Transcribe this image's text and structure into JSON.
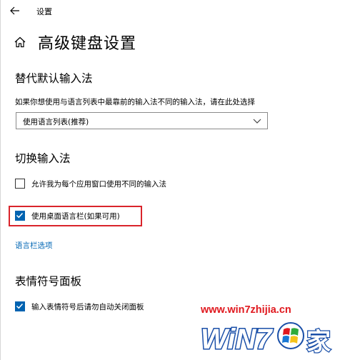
{
  "window": {
    "title": "设置"
  },
  "page": {
    "title": "高级键盘设置"
  },
  "section_default_input": {
    "title": "替代默认输入法",
    "description": "如果你想使用与语言列表中最靠前的输入法不同的输入法，请在此处选择",
    "dropdown": {
      "selected": "使用语言列表(推荐)"
    }
  },
  "section_switch_input": {
    "title": "切换输入法",
    "checkbox_per_app": {
      "label": "允许我为每个应用窗口使用不同的输入法",
      "checked": false
    },
    "checkbox_language_bar": {
      "label": "使用桌面语言栏(如果可用)",
      "checked": true
    },
    "language_bar_link": "语言栏选项"
  },
  "section_emoji": {
    "title": "表情符号面板",
    "checkbox_auto_close": {
      "label": "输入表情符号后请勿自动关闭面板",
      "checked": true
    }
  },
  "watermark": {
    "url": "www.win7zhijia.cn",
    "logo_text_left": "WiN7",
    "logo_text_right": "家"
  },
  "colors": {
    "accent": "#0063b1",
    "link": "#0066b4",
    "highlight": "#d9242b",
    "watermark_red": "#e0181e",
    "watermark_blue": "#1a4fa8"
  }
}
